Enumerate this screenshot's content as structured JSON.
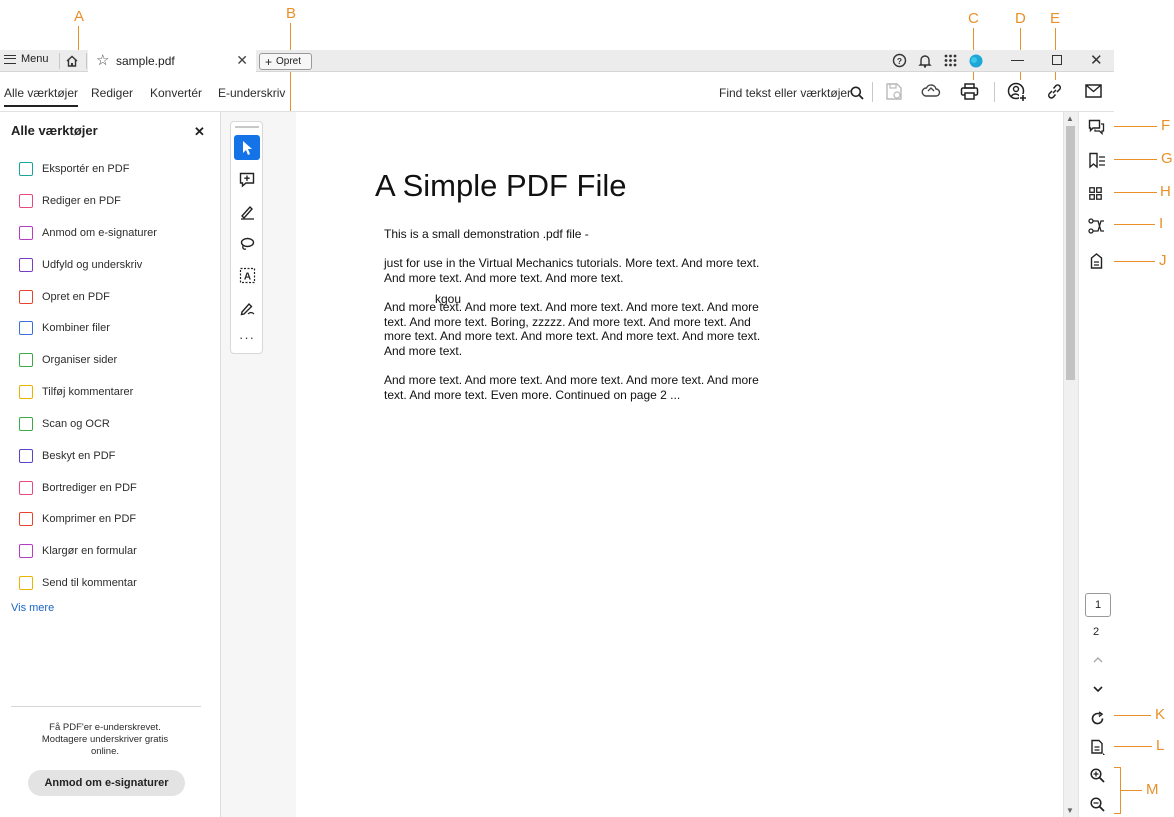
{
  "callouts": [
    "A",
    "B",
    "C",
    "D",
    "E",
    "F",
    "G",
    "H",
    "I",
    "J",
    "K",
    "L",
    "M"
  ],
  "titlebar": {
    "menu_label": "Menu",
    "tab_name": "sample.pdf",
    "opret_label": "Opret"
  },
  "tabs": [
    "Alle værktøjer",
    "Rediger",
    "Konvertér",
    "E-underskriv"
  ],
  "toolbar": {
    "find_label": "Find tekst eller værktøjer"
  },
  "left_panel": {
    "title": "Alle værktøjer",
    "tools": [
      {
        "label": "Eksportér en PDF",
        "color": "#1aa39b"
      },
      {
        "label": "Rediger en PDF",
        "color": "#e54b7a"
      },
      {
        "label": "Anmod om e-signaturer",
        "color": "#b23cc2"
      },
      {
        "label": "Udfyld og underskriv",
        "color": "#7b3cc2"
      },
      {
        "label": "Opret en PDF",
        "color": "#e5452f"
      },
      {
        "label": "Kombiner filer",
        "color": "#3b6fd8"
      },
      {
        "label": "Organiser sider",
        "color": "#3fa64a"
      },
      {
        "label": "Tilføj kommentarer",
        "color": "#e8b400"
      },
      {
        "label": "Scan og OCR",
        "color": "#3fa64a"
      },
      {
        "label": "Beskyt en PDF",
        "color": "#5a43c8"
      },
      {
        "label": "Bortrediger en PDF",
        "color": "#e54b7a"
      },
      {
        "label": "Komprimer en PDF",
        "color": "#e5452f"
      },
      {
        "label": "Klargør en formular",
        "color": "#b23cc2"
      },
      {
        "label": "Send til kommentar",
        "color": "#e8b400"
      }
    ],
    "more_link": "Vis mere",
    "promo_text": "Få PDF'er e-underskrevet. Modtagere underskriver gratis online.",
    "promo_button": "Anmod om e-signaturer"
  },
  "document": {
    "title": "A Simple PDF File",
    "paragraphs": [
      "This is a small demonstration .pdf file -",
      "just for use in the Virtual Mechanics tutorials. More text. And more text. And more text. And more text. And more text.",
      "And more text. And more text. And more text. And more text. And more text. And more text. Boring, zzzzz. And more text. And more text. And more text. And more text. And more text. And more text. And more text. And more text.",
      "And more text. And more text. And more text. And more text. And more text. And more text. Even more. Continued on page 2 ..."
    ],
    "overlay_text": "kgou"
  },
  "pager": {
    "current": "1",
    "next": "2"
  },
  "colors": {
    "accent": "#1473e6",
    "callout": "#e8902a",
    "link": "#1b64c4"
  }
}
